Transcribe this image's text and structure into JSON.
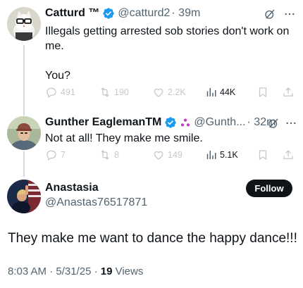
{
  "tweets": [
    {
      "display_name": "Catturd ™",
      "handle": "@catturd2",
      "time": "· 39m",
      "text": "Illegals getting arrested sob stories don't work on me.\n\nYou?",
      "replies": "491",
      "retweets": "190",
      "likes": "2.2K",
      "views": "44K"
    },
    {
      "display_name": "Gunther EaglemanTM",
      "handle": "@Gunth...",
      "time": "· 32m",
      "text": "Not at all!  They make me smile.",
      "replies": "7",
      "retweets": "8",
      "likes": "149",
      "views": "5.1K"
    }
  ],
  "main_tweet": {
    "display_name": "Anastasia",
    "handle": "@Anastas76517871",
    "follow_label": "Follow",
    "text": "They make me want to dance the happy dance!!!",
    "timestamp": "8:03 AM · 5/31/25 · ",
    "views_count": "19",
    "views_label": " Views"
  },
  "colors": {
    "verified_blue": "#1d9bf0",
    "secondary_text": "#536471",
    "thread_line": "#cfd9de",
    "follow_bg": "#0f1419",
    "affiliate_purple": "#c13ec4"
  },
  "icons": [
    "verified-icon",
    "grok-icon",
    "more-icon",
    "reply-icon",
    "retweet-icon",
    "like-icon",
    "views-icon",
    "bookmark-icon",
    "share-icon",
    "affiliate-badge-icon"
  ]
}
